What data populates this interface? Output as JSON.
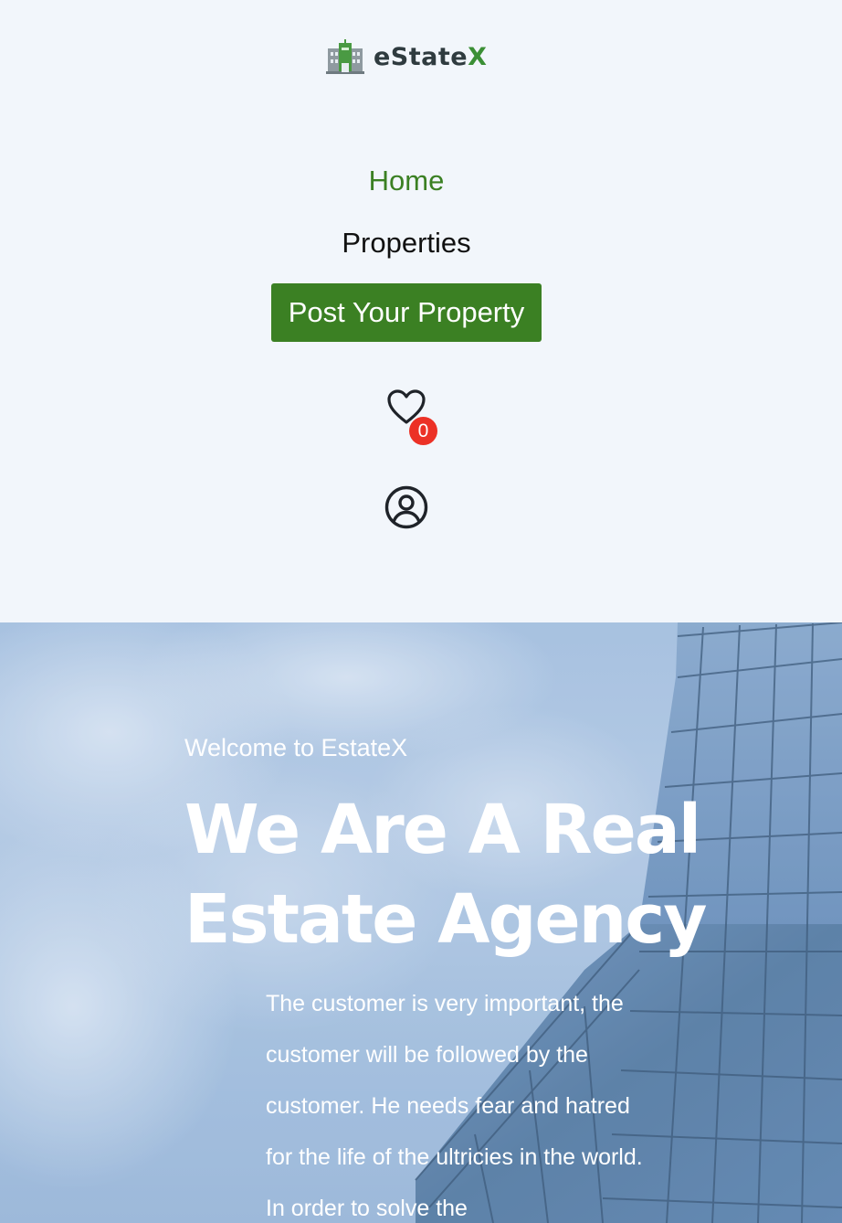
{
  "brand": {
    "name_main": "eState",
    "name_accent": "X",
    "accent_color": "#3b8f35"
  },
  "nav": {
    "home_label": "Home",
    "properties_label": "Properties",
    "post_button_label": "Post Your Property",
    "active_color": "#3b8023"
  },
  "wishlist": {
    "icon": "heart-icon",
    "count": "0",
    "badge_color": "#ec3126"
  },
  "account": {
    "icon": "user-circle-icon"
  },
  "hero": {
    "welcome": "Welcome to EstateX",
    "title": "We Are A Real Estate Agency",
    "text": "The customer is very important, the customer will be followed by the customer. He needs fear and hatred for the life of the ultricies in the world. In order to solve the"
  }
}
